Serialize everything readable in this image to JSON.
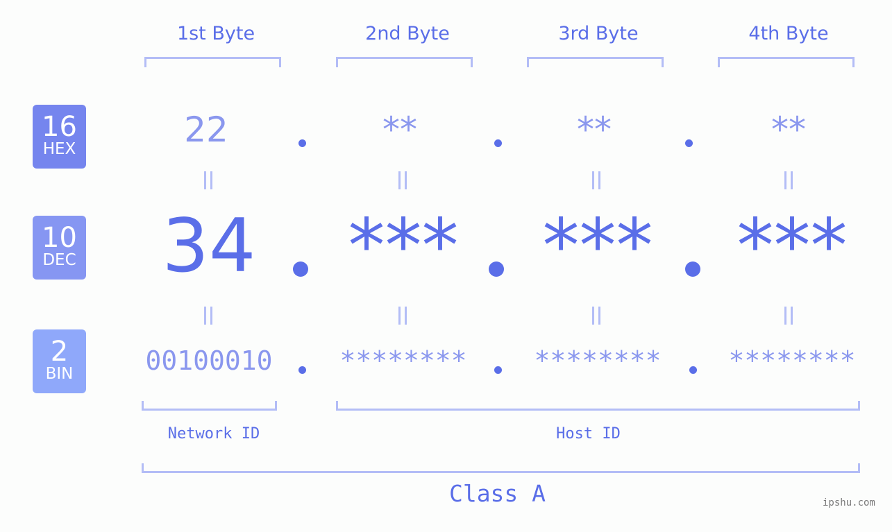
{
  "bytes": {
    "headers": [
      "1st Byte",
      "2nd Byte",
      "3rd Byte",
      "4th Byte"
    ],
    "hex": [
      "22",
      "**",
      "**",
      "**"
    ],
    "dec": [
      "34",
      "***",
      "***",
      "***"
    ],
    "bin": [
      "00100010",
      "********",
      "********",
      "********"
    ],
    "separator": "."
  },
  "badges": [
    {
      "number": "16",
      "label": "HEX",
      "color": "#7585ee"
    },
    {
      "number": "10",
      "label": "DEC",
      "color": "#8696f2"
    },
    {
      "number": "2",
      "label": "BIN",
      "color": "#8fa8fa"
    }
  ],
  "segments": {
    "network_label": "Network ID",
    "host_label": "Host ID",
    "class_label": "Class A"
  },
  "watermark": "ipshu.com",
  "colors": {
    "primary": "#5a6ee8",
    "light": "#8a97ee",
    "bracket": "#b3bdf6"
  }
}
